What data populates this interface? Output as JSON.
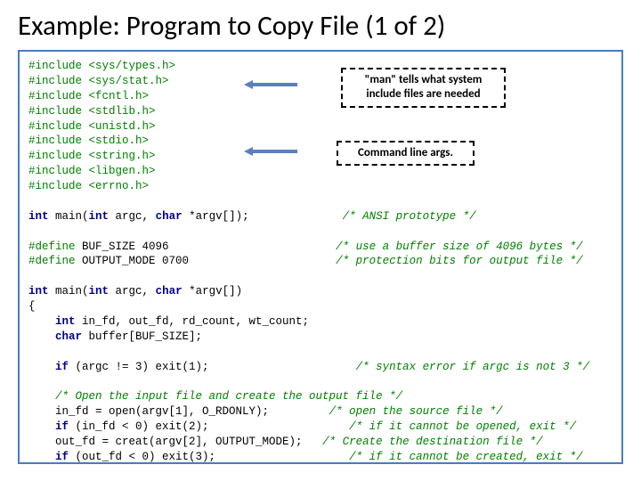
{
  "title": "Example: Program to Copy File (1 of 2)",
  "callouts": {
    "man": "\"man\" tells what system include files are needed",
    "args": "Command line args."
  },
  "code": {
    "includes": [
      "#include <sys/types.h>",
      "#include <sys/stat.h>",
      "#include <fcntl.h>",
      "#include <stdlib.h>",
      "#include <unistd.h>",
      "#include <stdio.h>",
      "#include <string.h>",
      "#include <libgen.h>",
      "#include <errno.h>"
    ],
    "proto": {
      "kwInt": "int",
      "main": " main(",
      "kwInt2": "int",
      "argc": " argc, ",
      "kwChar": "char",
      "argv": " *argv[]);",
      "cmt": "/* ANSI prototype */"
    },
    "defines": {
      "d1a": "#define",
      "d1b": " BUF_SIZE 4096",
      "d1c": "/* use a buffer size of 4096 bytes */",
      "d2a": "#define",
      "d2b": " OUTPUT_MODE 0700",
      "d2c": "/* protection bits for output file */"
    },
    "main": {
      "sig1": "int",
      "sig2": " main(",
      "sig3": "int",
      "sig4": " argc, ",
      "sig5": "char",
      "sig6": " *argv[])",
      "brace": "{",
      "decl1a": "    int",
      "decl1b": " in_fd, out_fd, rd_count, wt_count;",
      "decl2a": "    char",
      "decl2b": " buffer[BUF_SIZE];",
      "if1a": "    if",
      "if1b": " (argc != 3) exit(1);",
      "if1c": "/* syntax error if argc is not 3 */",
      "cmtOpen": "    /* Open the input file and create the output file */",
      "l1": "    in_fd = open(argv[1], O_RDONLY);",
      "l1c": "/* open the source file */",
      "if2a": "    if",
      "if2b": " (in_fd < 0) exit(2);",
      "if2c": "/* if it cannot be opened, exit */",
      "l3": "    out_fd = creat(argv[2], OUTPUT_MODE);",
      "l3c": "/* Create the destination file */",
      "if3a": "    if",
      "if3b": " (out_fd < 0) exit(3);",
      "if3c": "/* if it cannot be created, exit */"
    }
  }
}
